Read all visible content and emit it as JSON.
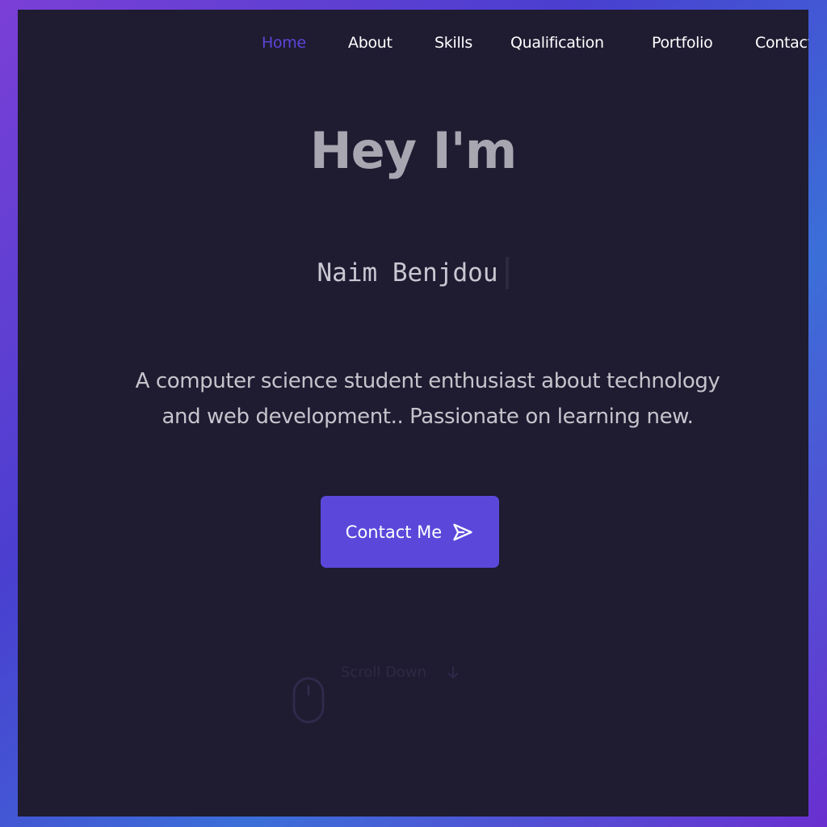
{
  "nav": {
    "items": [
      {
        "label": "Home",
        "active": true
      },
      {
        "label": "About"
      },
      {
        "label": "Skills"
      },
      {
        "label": "Qualification"
      },
      {
        "label": "Portfolio"
      },
      {
        "label": "Contact"
      }
    ]
  },
  "hero": {
    "greeting": "Hey I'm",
    "name": "Naim Benjdou",
    "description": "A computer science student enthusiast about technology and web development.. Passionate on learning new.",
    "contact_button": {
      "label": "Contact Me",
      "icon": "send-icon"
    }
  },
  "scroll": {
    "label": "Scroll Down",
    "icons": [
      "mouse-icon",
      "arrow-down-icon"
    ]
  },
  "colors": {
    "background": "#1f1b31",
    "accent": "#5b48db",
    "frame_gradient": [
      "#7b3fd6",
      "#3b6fd8"
    ]
  }
}
